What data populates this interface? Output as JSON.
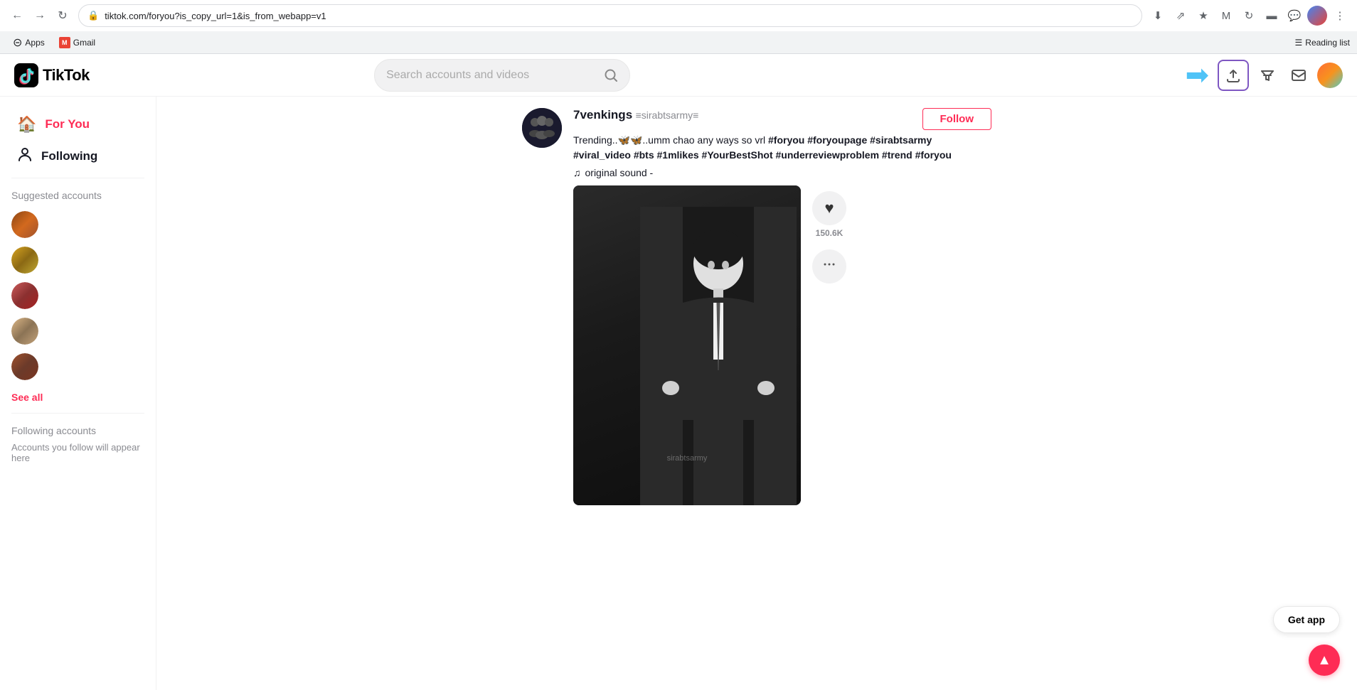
{
  "browser": {
    "url": "tiktok.com/foryou?is_copy_url=1&is_from_webapp=v1",
    "back_disabled": false,
    "forward_disabled": false,
    "bookmarks": [
      {
        "id": "apps",
        "label": "Apps",
        "icon": "⊞"
      },
      {
        "id": "gmail",
        "label": "Gmail",
        "icon": "M"
      }
    ],
    "reading_list_label": "Reading list"
  },
  "header": {
    "logo_text": "TikTok",
    "search_placeholder": "Search accounts and videos",
    "upload_tooltip": "Upload",
    "messages_tooltip": "Messages"
  },
  "sidebar": {
    "nav_items": [
      {
        "id": "for-you",
        "label": "For You",
        "icon": "🏠",
        "active": true
      },
      {
        "id": "following",
        "label": "Following",
        "icon": "👤",
        "active": false
      }
    ],
    "suggested_section_title": "Suggested accounts",
    "suggested_accounts": [
      {
        "id": "acc1",
        "gradient": "linear-gradient(135deg, #8B4513, #D2691E)"
      },
      {
        "id": "acc2",
        "gradient": "linear-gradient(135deg, #DAA520, #8B6914)"
      },
      {
        "id": "acc3",
        "gradient": "linear-gradient(135deg, #CD5C5C, #8B3030)"
      },
      {
        "id": "acc4",
        "gradient": "linear-gradient(135deg, #DEB887, #8B7355)"
      },
      {
        "id": "acc5",
        "gradient": "linear-gradient(135deg, #A0522D, #6B3A2A)"
      }
    ],
    "see_all_label": "See all",
    "following_section_title": "Following accounts",
    "following_empty_text": "Accounts you follow will appear here"
  },
  "post": {
    "username": "7venkings",
    "handle": "≡sirabtsarmy≡",
    "avatar_gradient": "linear-gradient(135deg, #1a1a2e, #16213e, #0f3460)",
    "description": "Trending..🦋🦋..umm chao any ways so vrl #foryou #foryoupage #sirabtsarmy #viral_video #bts #1mlikes #YourBestShot #underreviewproblem #trend #foryou",
    "sound": "original sound -",
    "follow_label": "Follow",
    "likes_count": "150.6K",
    "watermark": "sirabtsarmy",
    "action_icons": {
      "like": "♥",
      "comment": "···"
    }
  },
  "footer": {
    "get_app_label": "Get app",
    "scroll_top_icon": "▲"
  },
  "colors": {
    "tiktok_red": "#fe2c55",
    "tiktok_black": "#161823",
    "arrow_blue": "#4FC3F7",
    "upload_border": "#7e57c2"
  }
}
